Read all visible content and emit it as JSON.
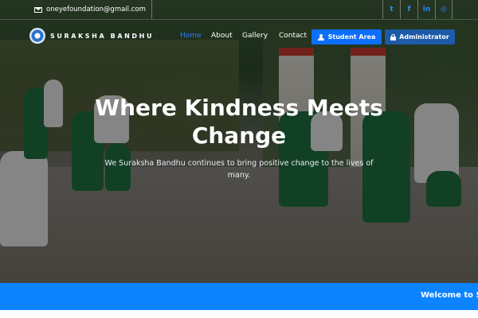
{
  "topbar": {
    "email": "oneyefoundation@gmail.com",
    "social": [
      {
        "icon": "twitter-icon",
        "glyph": "t"
      },
      {
        "icon": "facebook-icon",
        "glyph": "f"
      },
      {
        "icon": "linkedin-icon",
        "glyph": "in"
      },
      {
        "icon": "instagram-icon",
        "glyph": "◎"
      }
    ]
  },
  "nav": {
    "brand": "SURAKSHA BANDHU",
    "items": [
      "Home",
      "About",
      "Gallery",
      "Contact"
    ],
    "active_item": "Home",
    "student_button": "Student Area",
    "admin_button": "Administrator"
  },
  "hero": {
    "headline": "Where Kindness Meets Change",
    "subtext": "We Suraksha Bandhu continues to bring positive change to the lives of many."
  },
  "ticker": {
    "text": "Welcome to Su"
  },
  "colors": {
    "accent": "#0d6efd",
    "ticker_bg": "#0d84ff",
    "social_icon": "#2f88ff",
    "admin_button": "#1d5aa8"
  }
}
